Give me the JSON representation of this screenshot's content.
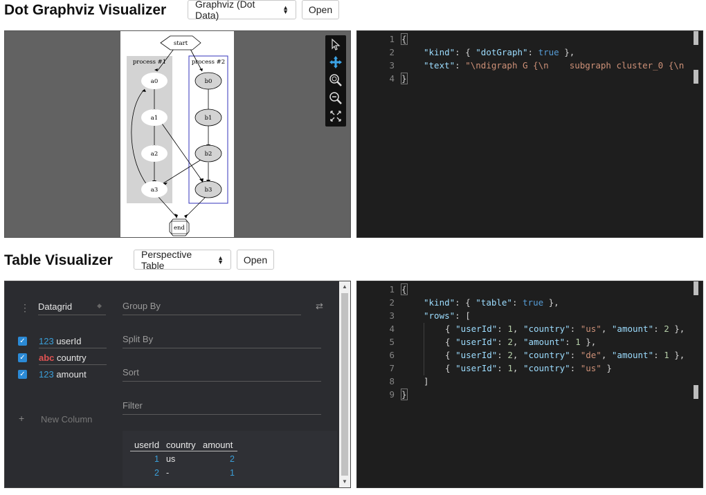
{
  "dot_section": {
    "title": "Dot Graphviz Visualizer",
    "select_value": "Graphviz (Dot Data)",
    "open_label": "Open",
    "graph": {
      "start": "start",
      "end": "end",
      "cluster1_label": "process #1",
      "cluster2_label": "process #2",
      "nodes_a": [
        "a0",
        "a1",
        "a2",
        "a3"
      ],
      "nodes_b": [
        "b0",
        "b1",
        "b2",
        "b3"
      ]
    },
    "tools": [
      "pointer-icon",
      "move-icon",
      "zoom-in-icon",
      "zoom-out-icon",
      "fit-icon"
    ],
    "editor": {
      "line_numbers": [
        "1",
        "2",
        "3",
        "4"
      ],
      "l2_key": "\"kind\"",
      "l2_open": ": { ",
      "l2_inner_key": "\"dotGraph\"",
      "l2_colon": ": ",
      "l2_val": "true",
      "l2_close": " },",
      "l3_key": "\"text\"",
      "l3_colon": ": ",
      "l3_val": "\"\\ndigraph G {\\n    subgraph cluster_0 {\\n"
    }
  },
  "table_section": {
    "title": "Table Visualizer",
    "select_value": "Perspective Table",
    "open_label": "Open",
    "plugin": "Datagrid",
    "group_by": "Group By",
    "split_by": "Split By",
    "sort": "Sort",
    "filter": "Filter",
    "new_column": "New Column",
    "columns": [
      {
        "type": "123",
        "name": "userId"
      },
      {
        "type": "abc",
        "name": "country"
      },
      {
        "type": "123",
        "name": "amount"
      }
    ],
    "grid": {
      "headers": [
        "userId",
        "country",
        "amount"
      ],
      "rows": [
        {
          "userId": "1",
          "country": "us",
          "amount": "2"
        },
        {
          "userId": "2",
          "country": "-",
          "amount": "1"
        }
      ]
    },
    "editor": {
      "line_numbers": [
        "1",
        "2",
        "3",
        "4",
        "5",
        "6",
        "7",
        "8",
        "9"
      ],
      "rows": [
        {
          "userId": "1",
          "country": "\"us\"",
          "amount": "2",
          "sep": " },"
        },
        {
          "userId": "2",
          "amount": "1",
          "sep": " },"
        },
        {
          "userId": "2",
          "country": "\"de\"",
          "amount": "1",
          "sep": " },"
        },
        {
          "userId": "1",
          "country": "\"us\"",
          "sep": " }"
        }
      ]
    }
  },
  "colors": {
    "editor_bg": "#1e1e1e",
    "json_key": "#9cdcfe",
    "json_string": "#ce9178",
    "json_bool": "#569cd6",
    "json_number": "#b5cea8",
    "accent": "#2b8ad6"
  }
}
